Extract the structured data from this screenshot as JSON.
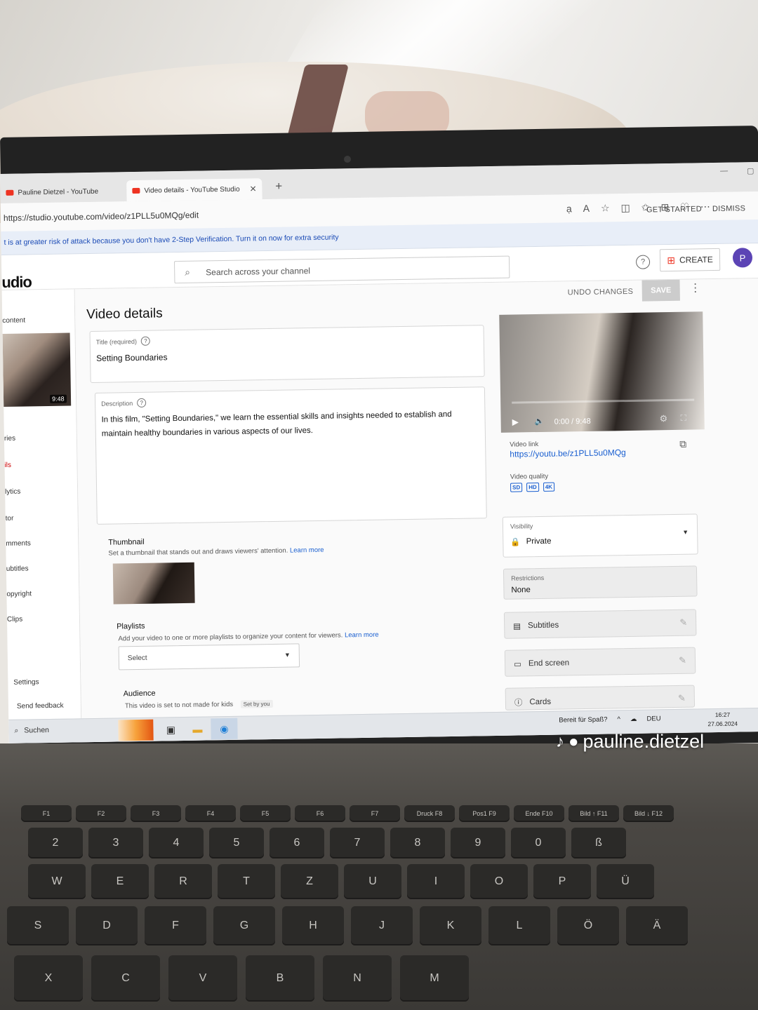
{
  "browser": {
    "tabs": [
      {
        "label": "Pauline Dietzel - YouTube"
      },
      {
        "label": "Video details - YouTube Studio"
      }
    ],
    "url": "https://studio.youtube.com/video/z1PLL5u0MQg/edit"
  },
  "banner": {
    "text": "t is at greater risk of attack because you don't have 2-Step Verification. Turn it on now for extra security",
    "get_started": "GET STARTED",
    "dismiss": "DISMISS"
  },
  "studio": {
    "logo": "udio",
    "search_placeholder": "Search across your channel",
    "help_icon": "?",
    "create_label": "CREATE",
    "avatar_initial": "P"
  },
  "sidebar": {
    "items": [
      {
        "label": "content"
      },
      {
        "label": "ries"
      },
      {
        "label": "ils"
      },
      {
        "label": "lytics"
      },
      {
        "label": "tor"
      },
      {
        "label": "mments"
      },
      {
        "label": "ubtitles"
      },
      {
        "label": "opyright"
      },
      {
        "label": "Clips"
      },
      {
        "label": "Settings"
      },
      {
        "label": "Send feedback"
      }
    ],
    "thumb_duration": "9:48"
  },
  "header": {
    "title": "Video details",
    "undo": "UNDO CHANGES",
    "save": "SAVE"
  },
  "form": {
    "title_label": "Title (required)",
    "title_value": "Setting Boundaries",
    "description_label": "Description",
    "description_value": "In this film, \"Setting Boundaries,\" we learn the essential skills and insights needed to establish and maintain healthy boundaries in various aspects of our lives.",
    "thumbnail_title": "Thumbnail",
    "thumbnail_sub": "Set a thumbnail that stands out and draws viewers' attention.",
    "learn_more": "Learn more",
    "playlists_title": "Playlists",
    "playlists_sub": "Add your video to one or more playlists to organize your content for viewers.",
    "playlists_select": "Select",
    "audience_title": "Audience",
    "audience_sub": "This video is set to not made for kids",
    "set_by_you": "Set by you"
  },
  "right_panel": {
    "player_time": "0:00 / 9:48",
    "video_link_label": "Video link",
    "video_link": "https://youtu.be/z1PLL5u0MQg",
    "video_quality_label": "Video quality",
    "quality_badges": [
      "SD",
      "HD",
      "4K"
    ],
    "visibility_label": "Visibility",
    "visibility_value": "Private",
    "restrictions_label": "Restrictions",
    "restrictions_value": "None",
    "subtitles": "Subtitles",
    "end_screen": "End screen",
    "cards": "Cards"
  },
  "taskbar": {
    "search": "Suchen",
    "notification": "Bereit für Spaß?",
    "language": "DEU",
    "time": "16:27",
    "date": "27.06.2024"
  },
  "keyboard": {
    "fn_row": [
      "F1",
      "F2",
      "F3",
      "F4",
      "F5",
      "F6",
      "F7",
      "Druck F8",
      "Pos1 F9",
      "Ende F10",
      "Bild ↑ F11",
      "Bild ↓ F12"
    ],
    "number_row": [
      "2",
      "3",
      "4",
      "5",
      "6",
      "7",
      "8",
      "9",
      "0",
      "ß"
    ],
    "top_row": [
      "W",
      "E",
      "R",
      "T",
      "Z",
      "U",
      "I",
      "O",
      "P",
      "Ü"
    ],
    "home_row": [
      "S",
      "D",
      "F",
      "G",
      "H",
      "J",
      "K",
      "L",
      "Ö",
      "Ä"
    ],
    "bottom_row": [
      "X",
      "C",
      "V",
      "B",
      "N",
      "M"
    ]
  },
  "watermark": "pauline.dietzel"
}
